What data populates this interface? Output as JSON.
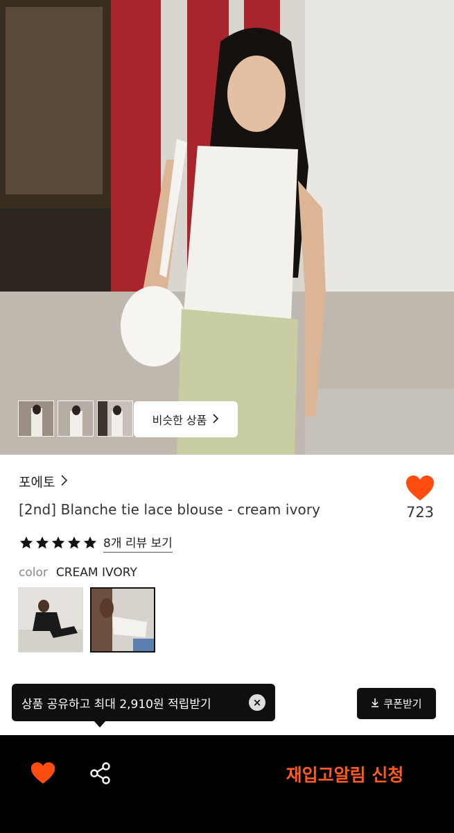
{
  "hero": {
    "similar_label": "비슷한 상품"
  },
  "product": {
    "brand": "포에토",
    "title": "[2nd] Blanche tie lace blouse - cream ivory",
    "like_count": "723",
    "rating_stars": 5,
    "review_link": "8개 리뷰 보기",
    "color_label": "color",
    "color_value": "CREAM IVORY"
  },
  "tooltip": {
    "text": "상품 공유하고 최대 2,910원 적립받기",
    "close": "×"
  },
  "coupon": {
    "label": "쿠폰받기"
  },
  "bottom_bar": {
    "restock_label": "재입고알림 신청"
  },
  "colors": {
    "accent": "#ff4d12",
    "bar": "#000000"
  }
}
